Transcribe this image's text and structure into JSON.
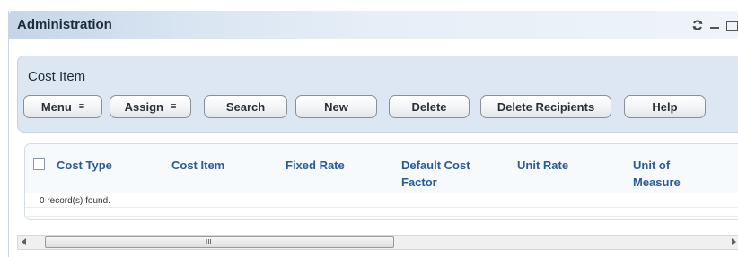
{
  "header": {
    "title": "Administration",
    "controls": [
      "refresh-icon",
      "minimize-icon",
      "maximize-icon"
    ]
  },
  "cost_item": {
    "title": "Cost Item",
    "buttons": {
      "menu": "Menu",
      "assign": "Assign",
      "search": "Search",
      "new": "New",
      "delete": "Delete",
      "delete_recipients": "Delete Recipients",
      "help": "Help"
    },
    "dropdown_caret": "≡"
  },
  "grid": {
    "columns": [
      "Cost Type",
      "Cost Item",
      "Fixed Rate",
      "Default Cost Factor",
      "Unit Rate",
      "Unit of Measure"
    ],
    "records_text": "0 record(s) found."
  },
  "scrollbar": {
    "grip": "III"
  },
  "colors": {
    "header_gradient_start": "#c5d6ea",
    "panel_background": "#dce7f3",
    "column_header_text": "#2a5a9a"
  }
}
